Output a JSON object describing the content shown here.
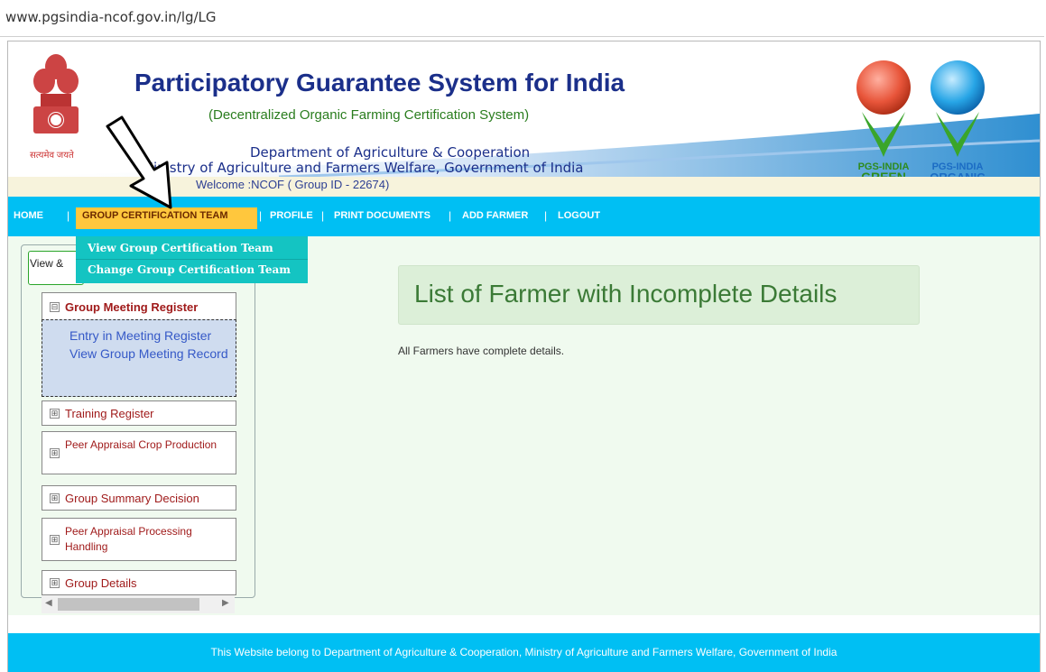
{
  "browser": {
    "url": "www.pgsindia-ncof.gov.in/lg/LG"
  },
  "header": {
    "emblem_caption": "सत्यमेव जयते",
    "title": "Participatory Guarantee System for India",
    "subtitle": "(Decentralized Organic Farming Certification System)",
    "department": "Department of Agriculture & Cooperation",
    "ministry": "Ministry of Agriculture and Farmers Welfare, Government of India",
    "welcome": "Welcome :NCOF ( Group ID - 22674)",
    "logos": [
      {
        "top": "PGS-INDIA",
        "bottom": "GREEN",
        "color": "#2e8b1d"
      },
      {
        "top": "PGS-INDIA",
        "bottom": "ORGANIC",
        "color": "#1b6cc4"
      }
    ]
  },
  "nav": {
    "items": [
      "HOME",
      "GROUP CERTIFICATION TEAM",
      "PROFILE",
      "PRINT DOCUMENTS",
      "ADD FARMER",
      "LOGOUT"
    ],
    "separator": "|",
    "active": "GROUP CERTIFICATION TEAM",
    "dropdown": [
      "View Group Certification Team",
      "Change Group Certification Team"
    ]
  },
  "sidebar": {
    "tab_label": "View &",
    "sections": [
      {
        "title": "Group Meeting Register",
        "expanded": true,
        "links": [
          "Entry in Meeting Register",
          "View Group Meeting Record"
        ]
      },
      {
        "title": "Training Register",
        "expanded": false
      },
      {
        "title": "Peer Appraisal Crop Production",
        "expanded": false
      },
      {
        "title": "Group Summary Decision",
        "expanded": false
      },
      {
        "title": "Peer Appraisal Processing Handling",
        "expanded": false
      },
      {
        "title": "Group Details",
        "expanded": false
      }
    ],
    "icons": {
      "expanded": "⊟",
      "collapsed": "⊞"
    }
  },
  "main": {
    "title": "List of Farmer with Incomplete Details",
    "message": "All Farmers have complete details."
  },
  "footer": {
    "text": "This Website belong to Department of Agriculture & Cooperation, Ministry of Agriculture and Farmers Welfare, Government of India"
  },
  "colors": {
    "nav_bg": "#00bff3",
    "nav_active": "#ffc73d",
    "dropdown_bg": "#14c4c2",
    "content_bg": "#f0faef",
    "title_blue": "#1b2f8a"
  }
}
